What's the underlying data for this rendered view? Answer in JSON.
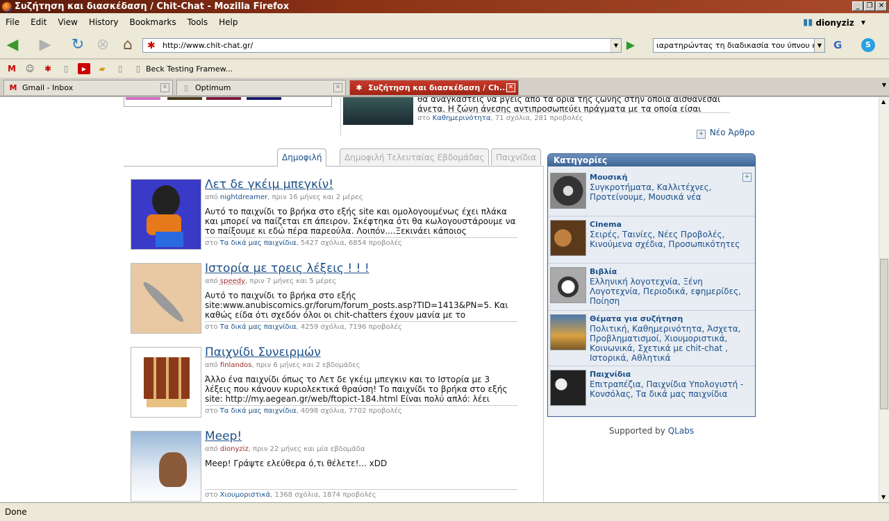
{
  "window": {
    "title": "Συζήτηση και διασκέδαση / Chit-Chat - Mozilla Firefox"
  },
  "menu": [
    "File",
    "Edit",
    "View",
    "History",
    "Bookmarks",
    "Tools",
    "Help"
  ],
  "user": "dionyziz",
  "url": "http://www.chit-chat.gr/",
  "search": "ιαρατηρώντας τη διαδικασία του ύπνου και''",
  "bookmarks": {
    "beck": "Beck Testing Framew..."
  },
  "tabs": [
    {
      "label": "Gmail - Inbox"
    },
    {
      "label": "Optimum"
    },
    {
      "label": "Συζήτηση και διασκέδαση / Ch..."
    }
  ],
  "top_article": {
    "text1": "θα αναγκαστείς να βγεις από τα όρια της ζώνης στην οποία αισθάνεσαι",
    "text2": "άνετα. Η ζώνη άνεσης αντιπροσωπεύει πράγματα με τα οποία είσαι",
    "meta_pre": "στο",
    "meta_cat": "Καθημερινότητα",
    "meta_rest": ", 71 σχόλια, 281 προβολές"
  },
  "new_article": "Νέο Άρθρο",
  "content_tabs": [
    "Δημοφιλή",
    "Δημοφιλή Τελευταίας Εβδομάδας",
    "Παιχνίδια"
  ],
  "posts": [
    {
      "title": "Λετ δε γκέιμ μπεγκίν!",
      "by": "από",
      "author": "nightdreamer",
      "when": ", πριν 16 μήνες και 2 μέρες",
      "text": "Αυτό το παιχνίδι το βρήκα στο εξής site και ομολογουμένως έχει πλάκα και μπορεί να παίζεται επ άπειρον. Σκέφτηκα ότι θα κωλογουστάρουμε να το παίξουμε κι εδώ πέρα παρεούλα. Λοιπόν....Ξεκινάει κάποιος",
      "in": "στο",
      "cat": "Τα δικά μας παιχνίδια",
      "stats": ", 5427 σχόλια, 6854 προβολές"
    },
    {
      "title": "Ιστορία με τρεις λέξεις ! ! !",
      "by": "από",
      "author": "speedy",
      "when": ", πριν 7 μήνες και 5 μέρες",
      "text": "Αυτό το παιχνίδι το βρήκα στο εξής site:www.anubiscomics.gr/forum/forum_posts.asp?TID=1413&PN=5. Και καθώς είδα ότι σχεδόν όλοι οι chit-chatters έχουν μανία με το",
      "in": "στο",
      "cat": "Τα δικά μας παιχνίδια",
      "stats": ", 4259 σχόλια, 7196 προβολές"
    },
    {
      "title": "Παιχνίδι Συνειρμών",
      "by": "από",
      "author": "finlandos",
      "when": ", πριν 6 μήνες και 2 εβδομάδες",
      "text": "Άλλο ένα παιχνίδι όπως το Λετ δε γκέιμ μπεγκιν και το Ιστορία με 3 λέξεις που κάνουν κυριολεκτικά θραύση! Το παιχνίδι το βρήκα στο εξής site: http://my.aegean.gr/web/ftopict-184.html Είναι πολύ απλό: λέει",
      "in": "στο",
      "cat": "Τα δικά μας παιχνίδια",
      "stats": ", 4098 σχόλια, 7702 προβολές"
    },
    {
      "title": "Meep!",
      "by": "από",
      "author": "dionyziz",
      "when": ", πριν 22 μήνες και μία εβδομάδα",
      "text": "Meep! Γράψτε ελεύθερα ό,τι θέλετε!... xDD",
      "in": "στο",
      "cat": "Χιουμοριστικά",
      "stats": ", 1368 σχόλια, 1874 προβολές"
    }
  ],
  "categories": {
    "header": "Κατηγορίες",
    "items": [
      {
        "name": "Μουσική",
        "links": "Συγκροτήματα, Καλλιτέχνες, Προτείνουμε, Μουσικά νέα"
      },
      {
        "name": "Cinema",
        "links": "Σειρές, Ταινίες, Νέες Προβολές, Κινούμενα σχέδια, Προσωπικότητες"
      },
      {
        "name": "Βιβλία",
        "links": "Ελληνική λογοτεχνία, Ξένη Λογοτεχνία, Περιοδικά, εφημερίδες, Ποίηση"
      },
      {
        "name": "Θέματα για συζήτηση",
        "links": "Πολιτική, Καθημερινότητα, Άσχετα, Προβληματισμοί, Χιουμοριστικά, Κοινωνικά, Σχετικά με chit-chat , Ιστορικά, Αθλητικά"
      },
      {
        "name": "Παιχνίδια",
        "links": "Επιτραπέζια, Παιχνίδια Υπολογιστή - Κονσόλας, Τα δικά μας παιχνίδια"
      }
    ]
  },
  "supported": {
    "pre": "Supported by ",
    "link": "QLabs"
  },
  "status": "Done"
}
